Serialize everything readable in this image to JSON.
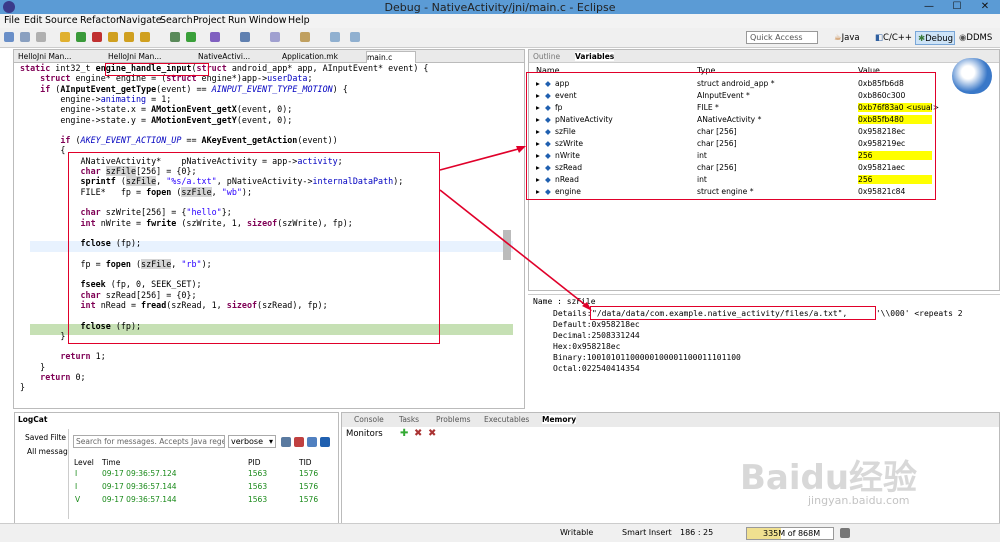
{
  "window": {
    "title": "Debug - NativeActivity/jni/main.c - Eclipse",
    "minimize": "—",
    "maximize": "☐",
    "close": "✕"
  },
  "menu": [
    "File",
    "Edit",
    "Source",
    "Refactor",
    "Navigate",
    "Search",
    "Project",
    "Run",
    "Window",
    "Help"
  ],
  "toolbar": {
    "quick_access_placeholder": "Quick Access",
    "perspectives": [
      "Java",
      "C/C++",
      "Debug",
      "DDMS"
    ]
  },
  "editor": {
    "tabs": [
      "HelloJni Man...",
      "HelloJni Man...",
      "NativeActivi...",
      "Application.mk",
      "main.c"
    ],
    "code_lines": [
      "static int32_t engine_handle_input(struct android_app* app, AInputEvent* event) {",
      "    struct engine* engine = (struct engine*)app->userData;",
      "    if (AInputEvent_getType(event) == AINPUT_EVENT_TYPE_MOTION) {",
      "        engine->animating = 1;",
      "        engine->state.x = AMotionEvent_getX(event, 0);",
      "        engine->state.y = AMotionEvent_getY(event, 0);",
      "",
      "        if (AKEY_EVENT_ACTION_UP == AKeyEvent_getAction(event))",
      "        {",
      "            ANativeActivity*    pNativeActivity = app->activity;",
      "            char szFile[256] = {0};",
      "            sprintf (szFile, \"%s/a.txt\", pNativeActivity->internalDataPath);",
      "            FILE*   fp = fopen (szFile, \"wb\");",
      "",
      "            char szWrite[256] = {\"hello\"};",
      "            int nWrite = fwrite (szWrite, 1, sizeof(szWrite), fp);",
      "",
      "            fclose (fp);",
      "",
      "            fp = fopen (szFile, \"rb\");",
      "",
      "            fseek (fp, 0, SEEK_SET);",
      "            char szRead[256] = {0};",
      "            int nRead = fread(szRead, 1, sizeof(szRead), fp);",
      "",
      "            fclose (fp);",
      "        }",
      "",
      "        return 1;",
      "    }",
      "    return 0;",
      "}"
    ]
  },
  "variables": {
    "tabs": [
      "Outline",
      "Variables"
    ],
    "headers": [
      "Name",
      "Type",
      "Value"
    ],
    "rows": [
      {
        "name": "app",
        "type": "struct android_app *",
        "value": "0xb85fb6d8",
        "changed": false
      },
      {
        "name": "event",
        "type": "AInputEvent *",
        "value": "0xb860c300",
        "changed": false
      },
      {
        "name": "fp",
        "type": "FILE *",
        "value": "0xb76f83a0 <usual>",
        "changed": true
      },
      {
        "name": "pNativeActivity",
        "type": "ANativeActivity *",
        "value": "0xb85fb480",
        "changed": true
      },
      {
        "name": "szFile",
        "type": "char [256]",
        "value": "0x958218ec",
        "changed": false
      },
      {
        "name": "szWrite",
        "type": "char [256]",
        "value": "0x958219ec",
        "changed": false
      },
      {
        "name": "nWrite",
        "type": "int",
        "value": "256",
        "changed": true
      },
      {
        "name": "szRead",
        "type": "char [256]",
        "value": "0x95821aec",
        "changed": false
      },
      {
        "name": "nRead",
        "type": "int",
        "value": "256",
        "changed": true
      },
      {
        "name": "engine",
        "type": "struct engine *",
        "value": "0x95821c84",
        "changed": false
      }
    ]
  },
  "details": {
    "name_line": "Name : szFile",
    "details_label": "Details:",
    "details_value": "\"/data/data/com.example.native_activity/files/a.txt\",",
    "details_tail": " '\\\\000' <repeats 2",
    "default": "Default:0x958218ec",
    "decimal": "Decimal:2508331244",
    "hex": "Hex:0x958218ec",
    "binary": "Binary:10010101100000100001100011101100",
    "octal": "Octal:022540414354"
  },
  "logcat": {
    "tab": "LogCat",
    "saved": "Saved Filte",
    "all": "All messag",
    "search_placeholder": "Search for messages. Accepts Java rege",
    "level_select": "verbose",
    "headers": [
      "Level",
      "Time",
      "PID",
      "TID"
    ],
    "rows": [
      {
        "level": "I",
        "time": "09-17 09:36:57.124",
        "pid": "1563",
        "tid": "1576"
      },
      {
        "level": "I",
        "time": "09-17 09:36:57.144",
        "pid": "1563",
        "tid": "1576"
      },
      {
        "level": "V",
        "time": "09-17 09:36:57.144",
        "pid": "1563",
        "tid": "1576"
      }
    ]
  },
  "console": {
    "tabs": [
      "Console",
      "Tasks",
      "Problems",
      "Executables",
      "Memory"
    ],
    "monitors": "Monitors"
  },
  "status": {
    "writable": "Writable",
    "insert": "Smart Insert",
    "pos": "186 : 25",
    "heap": "335M of 868M"
  },
  "watermark": {
    "brand": "Baidu经验",
    "url": "jingyan.baidu.com"
  },
  "colors": {
    "changed_value": "#ffff00",
    "annotation": "#e0002a",
    "keyword": "#7f0055",
    "string": "#2a00ff",
    "field": "#0000c0"
  }
}
